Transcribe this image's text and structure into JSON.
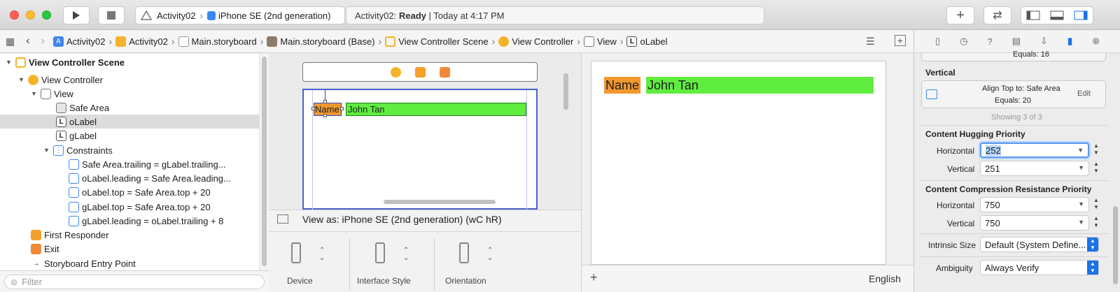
{
  "window": {
    "scheme_project": "Activity02",
    "scheme_device": "iPhone SE (2nd generation)",
    "status_project": "Activity02:",
    "status_state": "Ready",
    "status_time": "| Today at 4:17 PM"
  },
  "breadcrumbs": [
    {
      "label": "Activity02",
      "icon": "app-icon"
    },
    {
      "label": "Activity02",
      "icon": "folder-icon"
    },
    {
      "label": "Main.storyboard",
      "icon": "storyboard-icon"
    },
    {
      "label": "Main.storyboard (Base)",
      "icon": "storyboard-base-icon"
    },
    {
      "label": "View Controller Scene",
      "icon": "scene-icon"
    },
    {
      "label": "View Controller",
      "icon": "view-controller-icon"
    },
    {
      "label": "View",
      "icon": "view-icon"
    },
    {
      "label": "oLabel",
      "icon": "label-icon"
    }
  ],
  "outline": {
    "items": [
      {
        "label": "View Controller Scene",
        "bold": true
      },
      {
        "label": "View Controller"
      },
      {
        "label": "View"
      },
      {
        "label": "Safe Area"
      },
      {
        "label": "oLabel",
        "selected": true
      },
      {
        "label": "gLabel"
      },
      {
        "label": "Constraints"
      },
      {
        "label": "Safe Area.trailing = gLabel.trailing..."
      },
      {
        "label": "oLabel.leading = Safe Area.leading..."
      },
      {
        "label": "oLabel.top = Safe Area.top + 20"
      },
      {
        "label": "gLabel.top = Safe Area.top + 20"
      },
      {
        "label": "gLabel.leading = oLabel.trailing + 8"
      },
      {
        "label": "First Responder"
      },
      {
        "label": "Exit"
      },
      {
        "label": "Storyboard Entry Point"
      }
    ],
    "filter_placeholder": "Filter"
  },
  "canvas": {
    "name_label": "Name",
    "value_label": "John Tan"
  },
  "bottom": {
    "view_as": "View as: iPhone SE (2nd generation)",
    "size_class": "(wC hR)",
    "options": [
      "Device",
      "Interface Style",
      "Orientation"
    ]
  },
  "preview": {
    "name_label": "Name",
    "value_label": "John Tan",
    "language": "English",
    "add": "+"
  },
  "inspector": {
    "equals_top": "Equals:  16",
    "vertical_title": "Vertical",
    "align_top": "Align Top to:  Safe Area",
    "equals": "Equals:  20",
    "edit": "Edit",
    "showing": "Showing 3 of 3",
    "hugging_title": "Content Hugging Priority",
    "hugging_h_label": "Horizontal",
    "hugging_h_value": "252",
    "hugging_v_label": "Vertical",
    "hugging_v_value": "251",
    "compression_title": "Content Compression Resistance Priority",
    "comp_h_label": "Horizontal",
    "comp_h_value": "750",
    "comp_v_label": "Vertical",
    "comp_v_value": "750",
    "intrinsic_label": "Intrinsic Size",
    "intrinsic_value": "Default (System Define...",
    "ambiguity_label": "Ambiguity",
    "ambiguity_value": "Always Verify"
  },
  "colors": {
    "orange": "#f0982e",
    "green": "#5fee3f",
    "selection": "#1a73e8"
  }
}
